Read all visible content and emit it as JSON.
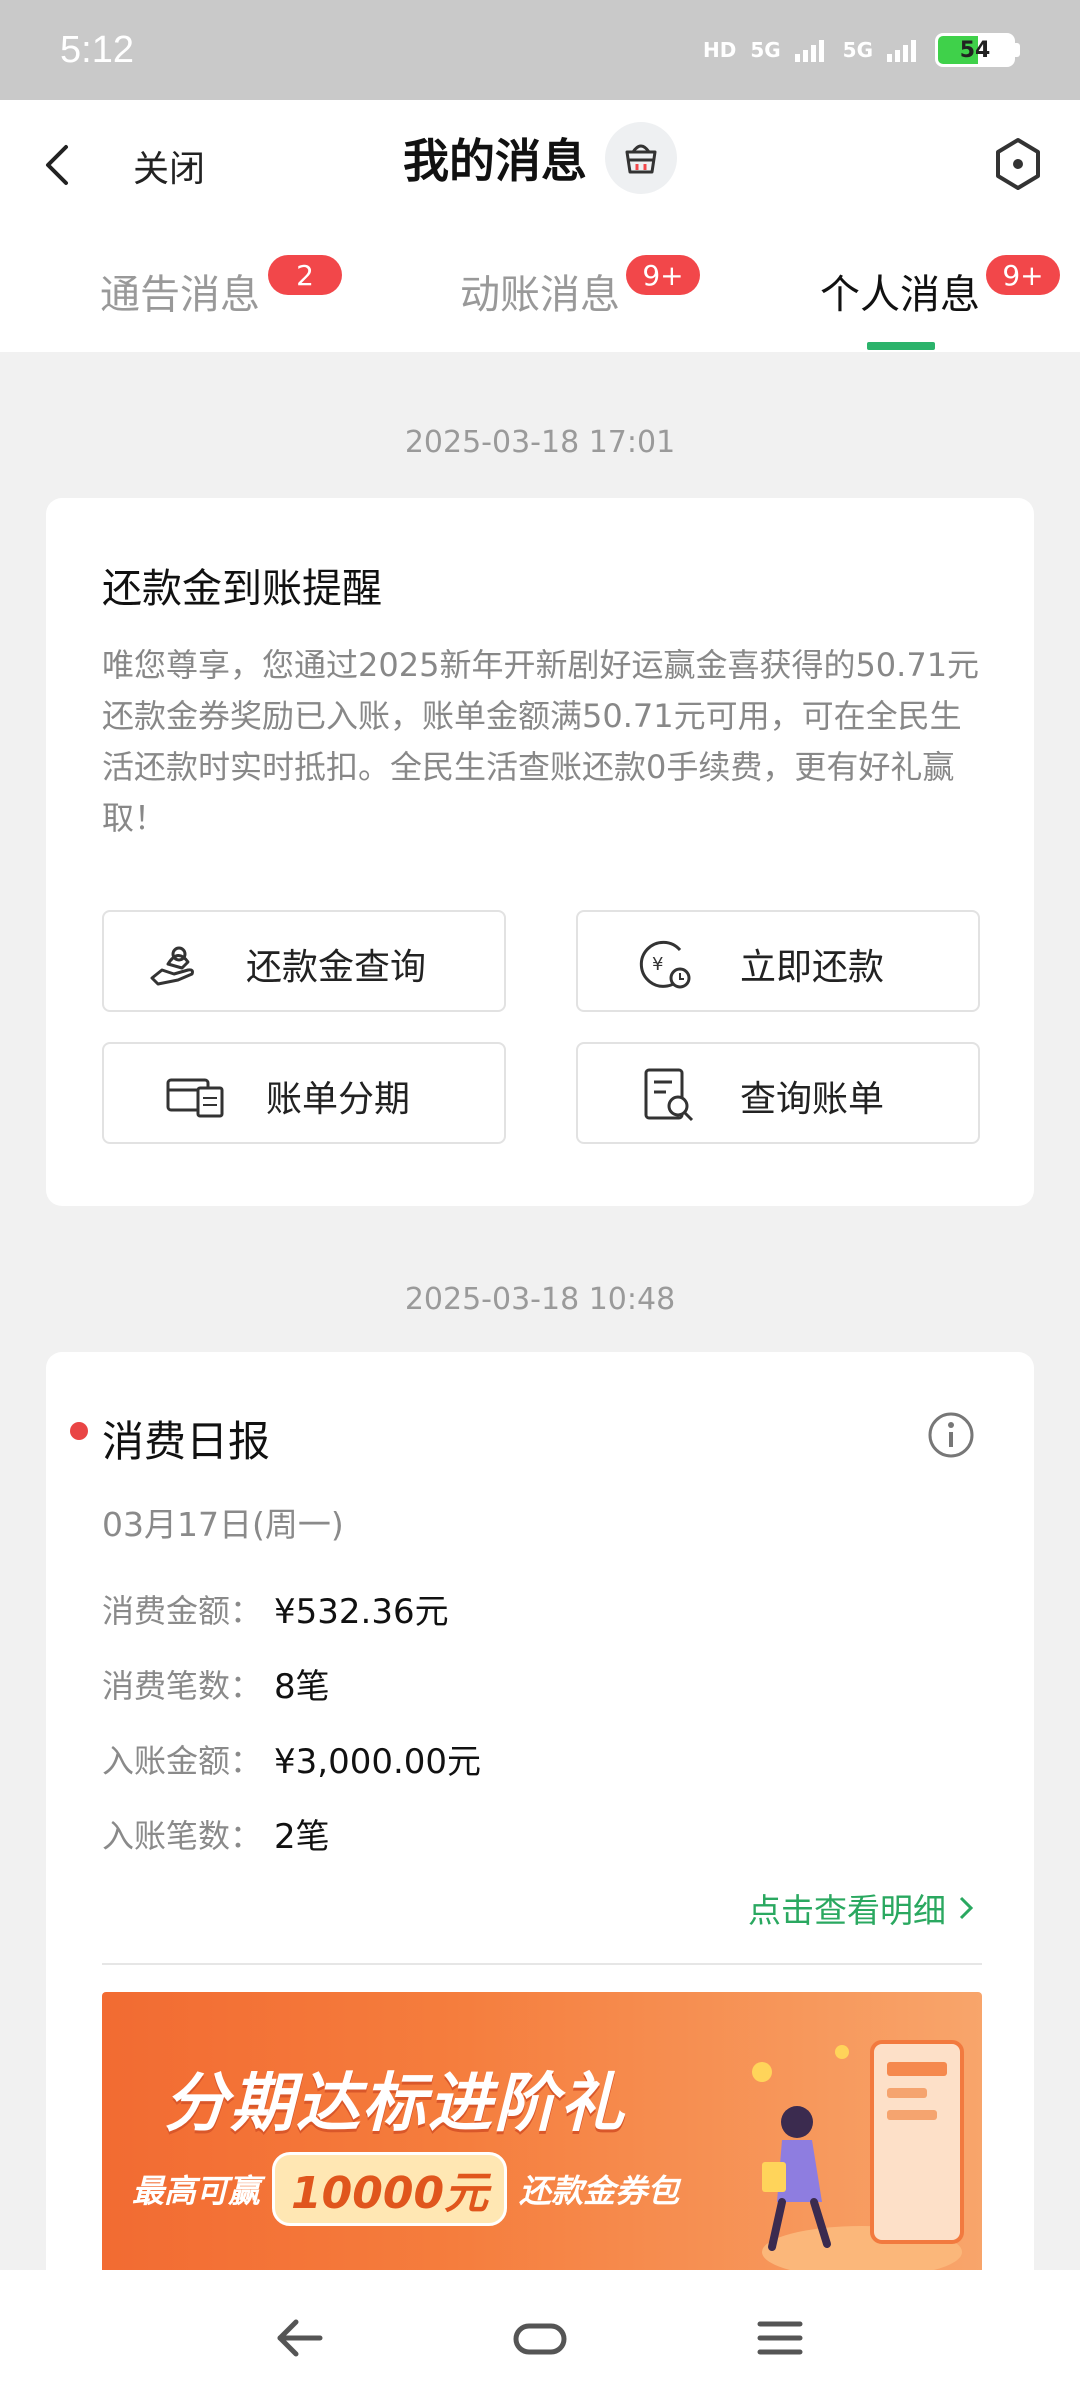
{
  "status": {
    "time": "5:12",
    "hd": "HD",
    "net1": "5G",
    "net2": "5G",
    "battery": "54",
    "battery_level": 0.54
  },
  "header": {
    "close_label": "关闭",
    "title": "我的消息"
  },
  "tabs": [
    {
      "label": "通告消息",
      "badge": "2"
    },
    {
      "label": "动账消息",
      "badge": "9+"
    },
    {
      "label": "个人消息",
      "badge": "9+"
    }
  ],
  "messages": {
    "first": {
      "timestamp": "2025-03-18 17:01",
      "title": "还款金到账提醒",
      "body": "唯您尊享，您通过2025新年开新剧好运赢金喜获得的50.71元还款金券奖励已入账，账单金额满50.71元可用，可在全民生活还款时实时抵扣。全民生活查账还款0手续费，更有好礼赢取！",
      "actions": [
        "还款金查询",
        "立即还款",
        "账单分期",
        "查询账单"
      ]
    },
    "second": {
      "timestamp": "2025-03-18 10:48",
      "title": "消费日报",
      "date": "03月17日(周一)",
      "rows": [
        {
          "label": "消费金额：",
          "value": "¥532.36元"
        },
        {
          "label": "消费笔数：",
          "value": "8笔"
        },
        {
          "label": "入账金额：",
          "value": "¥3,000.00元"
        },
        {
          "label": "入账笔数：",
          "value": "2笔"
        }
      ],
      "detail_link": "点击查看明细",
      "banner": {
        "title": "分期达标进阶礼",
        "sub_prefix": "最高可赢",
        "amount": "10000元",
        "sub_suffix": "还款金券包"
      }
    }
  },
  "colors": {
    "accent": "#2bb36b",
    "badge": "#f2474a",
    "link": "#2aa860"
  }
}
